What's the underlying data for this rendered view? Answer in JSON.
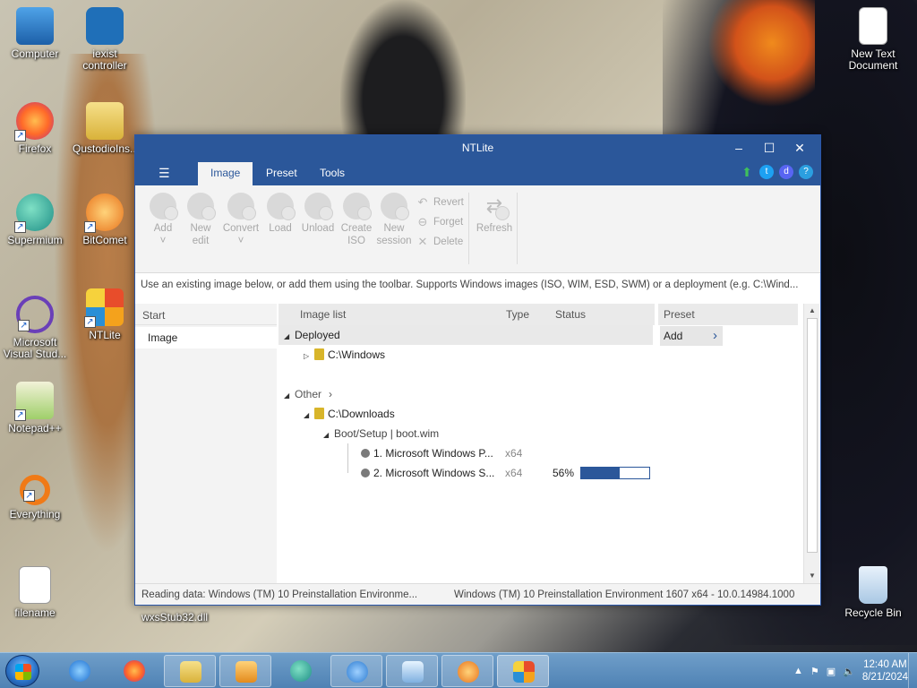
{
  "desktop": {
    "icons": [
      {
        "label": "Computer"
      },
      {
        "label": "iexist controller"
      },
      {
        "label": "Firefox"
      },
      {
        "label": "QustodioIns..."
      },
      {
        "label": "Supermium"
      },
      {
        "label": "BitComet"
      },
      {
        "label": "Microsoft Visual Stud..."
      },
      {
        "label": "NTLite"
      },
      {
        "label": "Notepad++"
      },
      {
        "label": "Everything"
      },
      {
        "label": "filename"
      },
      {
        "label": "New Text Document"
      },
      {
        "label": "Recycle Bin"
      }
    ],
    "wxs_label": "wxsStub32.dll"
  },
  "window": {
    "title": "NTLite",
    "menu_icon": "hamburger-icon",
    "tabs": [
      {
        "label": "Image",
        "active": true
      },
      {
        "label": "Preset"
      },
      {
        "label": "Tools"
      }
    ],
    "controls": {
      "minimize": "–",
      "maximize": "☐",
      "close": "✕"
    }
  },
  "toolbar": {
    "buttons": [
      {
        "label": "Add",
        "sub": "˅"
      },
      {
        "label": "New edit"
      },
      {
        "label": "Convert",
        "sub": "˅"
      },
      {
        "label": "Load"
      },
      {
        "label": "Unload"
      },
      {
        "label": "Create ISO"
      },
      {
        "label": "New session"
      }
    ],
    "small": [
      {
        "label": "Revert",
        "icon": "↶"
      },
      {
        "label": "Forget",
        "icon": "⊖"
      },
      {
        "label": "Delete",
        "icon": "✕"
      }
    ],
    "refresh": "Refresh"
  },
  "info": "Use an existing image below, or add them using the toolbar. Supports Windows images (ISO, WIM, ESD, SWM) or a deployment (e.g. C:\\Wind...",
  "nav": {
    "header": "Start",
    "items": [
      "Image"
    ]
  },
  "image_list": {
    "columns": [
      "Image list",
      "Type",
      "Status"
    ],
    "deployed_label": "Deployed",
    "deployed_path": "C:\\Windows",
    "other_label": "Other",
    "downloads_path": "C:\\Downloads",
    "boot_setup": "Boot/Setup  |  boot.wim",
    "images": [
      {
        "name": "1. Microsoft Windows P...",
        "type": "x64",
        "status": ""
      },
      {
        "name": "2. Microsoft Windows S...",
        "type": "x64",
        "status": "56%",
        "progress": 0.56
      }
    ]
  },
  "preset": {
    "header": "Preset",
    "add": "Add",
    "add_chevron": "›"
  },
  "statusbar": {
    "left": "Reading data: Windows (TM) 10 Preinstallation Environme...",
    "right": "Windows (TM) 10 Preinstallation Environment 1607 x64 - 10.0.14984.1000"
  },
  "taskbar": {
    "time": "12:40 AM",
    "date": "8/21/2024"
  },
  "colors": {
    "accent": "#2b579a"
  }
}
